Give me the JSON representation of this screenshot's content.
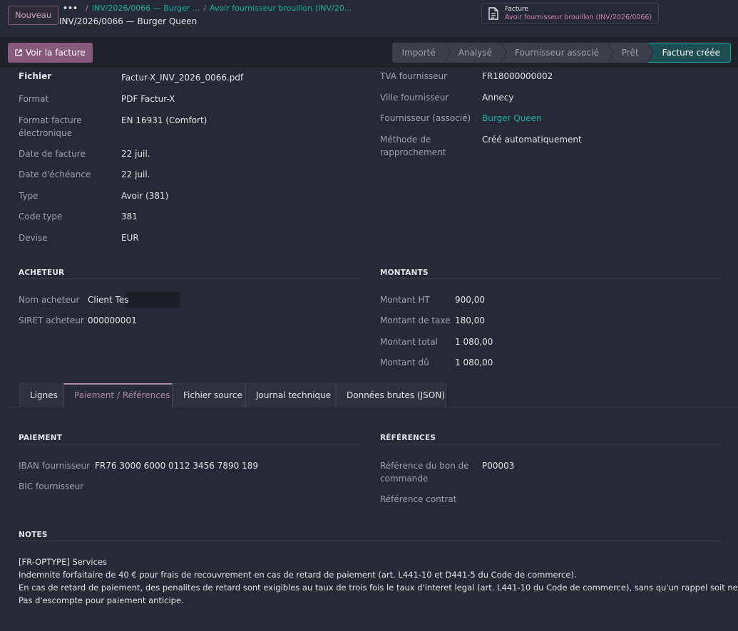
{
  "header": {
    "new_button": "Nouveau",
    "breadcrumb_dots": "•••",
    "breadcrumb_1": "INV/2026/0066 — Burger ...",
    "breadcrumb_2": "Avoir fournisseur brouillon (INV/20...",
    "record_title": "INV/2026/0066 — Burger Queen",
    "attachment_label": "Facture",
    "attachment_name": "Avoir fournisseur brouillon (INV/2026/0066)"
  },
  "controls": {
    "view_invoice_button": "Voir la facture",
    "status_steps": [
      "Importé",
      "Analysé",
      "Fournisseur associé",
      "Prêt",
      "Facture créée"
    ],
    "active_step": "Facture créée"
  },
  "left_fields": [
    {
      "label": "Fichier",
      "value": "Factur-X_INV_2026_0066.pdf"
    },
    {
      "label": "Format",
      "value": "PDF Factur-X"
    },
    {
      "label": "Format facture électronique",
      "value": "EN 16931 (Comfort)"
    },
    {
      "label": "Date de facture",
      "value": "22 juil."
    },
    {
      "label": "Date d'échéance",
      "value": "22 juil."
    },
    {
      "label": "Type",
      "value": "Avoir (381)"
    },
    {
      "label": "Code type",
      "value": "381"
    },
    {
      "label": "Devise",
      "value": "EUR"
    }
  ],
  "right_fields": [
    {
      "label": "TVA fournisseur",
      "value": "FR18000000002"
    },
    {
      "label": "Ville fournisseur",
      "value": "Annecy"
    },
    {
      "label": "Fournisseur (associé)",
      "value": "Burger Queen"
    },
    {
      "label": "Méthode de rapprochement",
      "value": "Créé automatiquement"
    }
  ],
  "buyer": {
    "title": "ACHETEUR",
    "fields": [
      {
        "label": "Nom acheteur",
        "value": "Client Tes"
      },
      {
        "label": "SIRET acheteur",
        "value": "000000001"
      }
    ]
  },
  "amounts": {
    "title": "MONTANTS",
    "fields": [
      {
        "label": "Montant HT",
        "value": "900,00"
      },
      {
        "label": "Montant de taxe",
        "value": "180,00"
      },
      {
        "label": "Montant total",
        "value": "1 080,00"
      },
      {
        "label": "Montant dû",
        "value": "1 080,00"
      }
    ]
  },
  "tabs": [
    "Lignes",
    "Paiement / Références",
    "Fichier source",
    "Journal technique",
    "Données brutes (JSON)"
  ],
  "active_tab": "Paiement / Références",
  "payment": {
    "title": "PAIEMENT",
    "fields": [
      {
        "label": "IBAN fournisseur",
        "value": "FR76 3000 6000 0112 3456 7890 189"
      },
      {
        "label": "BIC fournisseur",
        "value": ""
      }
    ]
  },
  "references": {
    "title": "RÉFÉRENCES",
    "fields": [
      {
        "label": "Référence du bon de commande",
        "value": "P00003"
      },
      {
        "label": "Référence contrat",
        "value": ""
      }
    ]
  },
  "notes": {
    "title": "NOTES",
    "lines": [
      "[FR-OPTYPE] Services",
      "Indemnite forfaitaire de 40 € pour frais de recouvrement en cas de retard de paiement (art. L441-10 et D441-5 du Code de commerce).",
      "En cas de retard de paiement, des penalites de retard sont exigibles au taux de trois fois le taux d'interet legal (art. L441-10 du Code de commerce), sans qu'un rappel soit necessaire.",
      "Pas d'escompte pour paiement anticipe."
    ]
  },
  "colors": {
    "accent_purple": "#875a7b",
    "link_teal": "#17b2a6",
    "background": "#262a36"
  }
}
